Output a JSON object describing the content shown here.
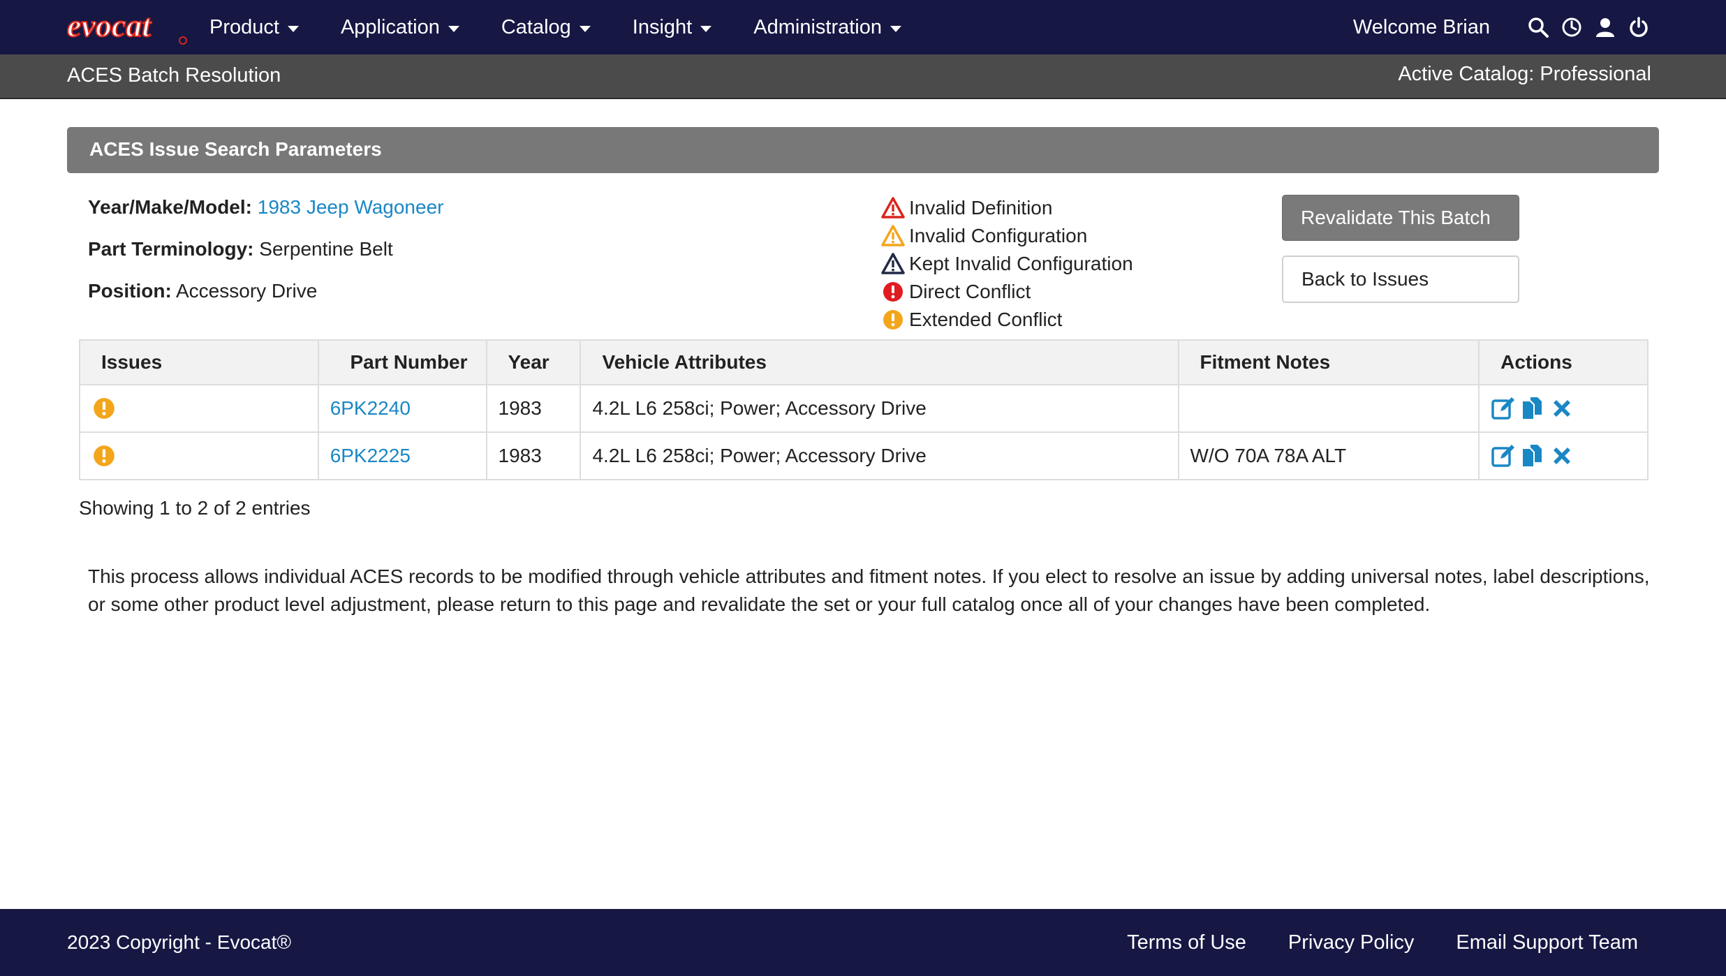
{
  "nav": {
    "logo_text": "evocat",
    "menu": [
      {
        "label": "Product"
      },
      {
        "label": "Application"
      },
      {
        "label": "Catalog"
      },
      {
        "label": "Insight"
      },
      {
        "label": "Administration"
      }
    ],
    "welcome": "Welcome Brian",
    "icons": [
      "search-icon",
      "history-icon",
      "user-icon",
      "power-icon"
    ]
  },
  "subheader": {
    "title": "ACES Batch Resolution",
    "active_catalog": "Active Catalog: Professional"
  },
  "panel": {
    "title": "ACES Issue Search Parameters"
  },
  "params": {
    "ymm_label": "Year/Make/Model:",
    "ymm_value": "1983 Jeep Wagoneer",
    "terminology_label": "Part Terminology:",
    "terminology_value": "Serpentine Belt",
    "position_label": "Position:",
    "position_value": "Accessory Drive"
  },
  "legend": [
    {
      "label": "Invalid Definition",
      "icon": "warning-red-icon",
      "color": "#d9251d"
    },
    {
      "label": "Invalid Configuration",
      "icon": "warning-orange-icon",
      "color": "#f3a51b"
    },
    {
      "label": "Kept Invalid Configuration",
      "icon": "warning-dark-icon",
      "color": "#222a45"
    },
    {
      "label": "Direct Conflict",
      "icon": "exclamation-red-icon",
      "color": "#e01b22"
    },
    {
      "label": "Extended Conflict",
      "icon": "exclamation-orange-icon",
      "color": "#f3a51b"
    }
  ],
  "buttons": {
    "revalidate": "Revalidate This Batch",
    "back": "Back to Issues"
  },
  "table": {
    "headers": [
      "Issues",
      "Part Number",
      "Year",
      "Vehicle Attributes",
      "Fitment Notes",
      "Actions"
    ],
    "rows": [
      {
        "issue_icon": "exclamation-orange-icon",
        "part_number": "6PK2240",
        "year": "1983",
        "attributes": "4.2L L6 258ci; Power; Accessory Drive",
        "notes": ""
      },
      {
        "issue_icon": "exclamation-orange-icon",
        "part_number": "6PK2225",
        "year": "1983",
        "attributes": "4.2L L6 258ci; Power; Accessory Drive",
        "notes": "W/O 70A 78A ALT"
      }
    ],
    "action_icons": [
      "edit-icon",
      "copy-icon",
      "delete-icon"
    ]
  },
  "showing": "Showing 1 to 2 of 2 entries",
  "note": "This process allows individual ACES records to be modified through vehicle attributes and fitment notes. If you elect to resolve an issue by adding universal notes, label descriptions, or some other product level adjustment, please return to this page and revalidate the set or your full catalog once all of your changes have been completed.",
  "footer": {
    "copyright": "2023 Copyright - Evocat®",
    "links": [
      "Terms of Use",
      "Privacy Policy",
      "Email Support Team"
    ]
  },
  "colors": {
    "nav_bg": "#161743",
    "subheader_bg": "#4b4b4b",
    "panel_bg": "#787878",
    "link": "#1a87c5",
    "action_blue": "#1a87c5",
    "logo_red": "#d9251d"
  }
}
